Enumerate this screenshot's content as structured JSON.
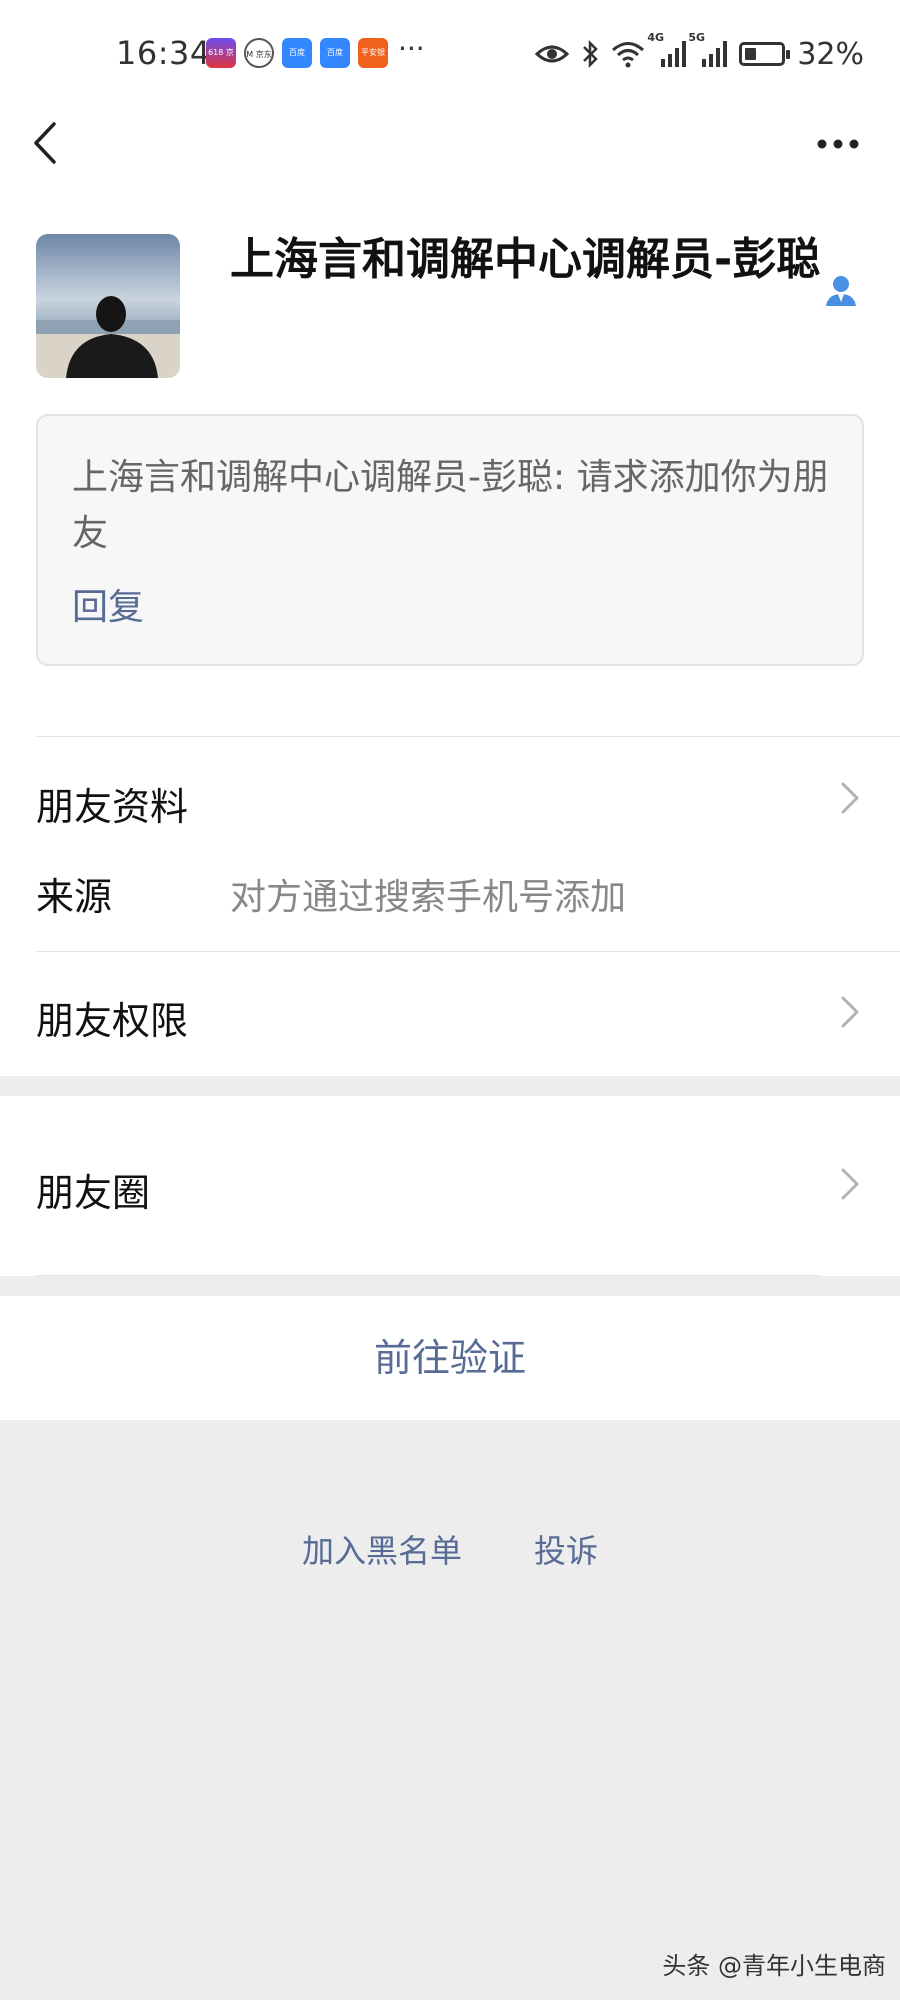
{
  "status_bar": {
    "time": "16:34",
    "app_icons": [
      {
        "name": "jd-618-app-icon",
        "label": "618 京东",
        "color": "#e0343c"
      },
      {
        "name": "jd-m-app-icon",
        "label": "M 京东",
        "color": "#ffffff"
      },
      {
        "name": "baidu-app-icon-1",
        "label": "百度",
        "color": "#3388ff"
      },
      {
        "name": "baidu-app-icon-2",
        "label": "百度",
        "color": "#3388ff"
      },
      {
        "name": "pingan-bank-app-icon",
        "label": "平安银行",
        "color": "#f0611d"
      }
    ],
    "more_indicator": "···",
    "net_4g": "4G",
    "net_5g": "5G",
    "battery_percent": "32%",
    "battery_level": 0.32
  },
  "nav": {
    "back_icon": "chevron-left-icon",
    "more_icon": "more-dots-icon"
  },
  "profile": {
    "name": "上海言和调解中心调解员-彭聪",
    "avatar": "avatar-image",
    "badge_icon": "person-icon"
  },
  "request": {
    "message": "上海言和调解中心调解员-彭聪: 请求添加你为朋友",
    "reply_label": "回复"
  },
  "rows": {
    "friend_profile": "朋友资料",
    "source_label": "来源",
    "source_value": "对方通过搜索手机号添加",
    "friend_permissions": "朋友权限",
    "moments": "朋友圈"
  },
  "action": {
    "verify_label": "前往验证"
  },
  "footer": {
    "blacklist_label": "加入黑名单",
    "complain_label": "投诉"
  },
  "watermark": "头条 @青年小生电商",
  "colors": {
    "link": "#576b95",
    "page_bg": "#ededed",
    "card_bg": "#ffffff"
  }
}
